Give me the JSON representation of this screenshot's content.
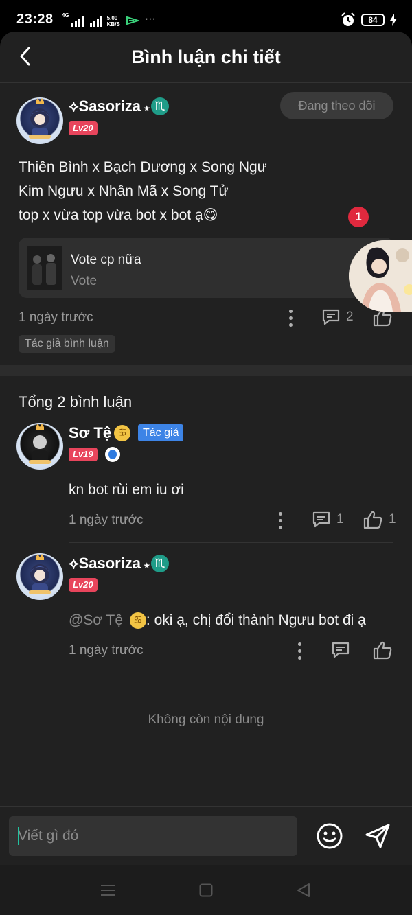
{
  "status_bar": {
    "time": "23:28",
    "network": "4G",
    "speed_value": "5.00",
    "speed_unit": "KB/S",
    "more": "···",
    "battery": "84"
  },
  "header": {
    "title": "Bình luận chi tiết"
  },
  "post": {
    "username": "Sasoriza",
    "zodiac_glyph": "♏",
    "level": "Lv20",
    "follow_label": "Đang theo dõi",
    "lines": [
      "Thiên Bình x Bạch Dương x Song Ngư",
      "Kim Ngưu x Nhân Mã x Song Tử",
      "top x vừa top vừa bot x bot ạ😋"
    ],
    "vote": {
      "title": "Vote cp nữa",
      "subtitle": "Vote"
    },
    "time": "1 ngày trước",
    "reply_count": "2",
    "author_tag": "Tác giả bình luận"
  },
  "floating": {
    "badge": "1"
  },
  "comments_section": {
    "total": "Tổng 2 bình luận",
    "comments": [
      {
        "username": "Sơ Tệ",
        "zodiac_glyph": "♋",
        "author_pill": "Tác giả",
        "level": "Lv19",
        "text": "kn bot rùi em iu ơi",
        "time": "1 ngày trước",
        "reply_count": "1",
        "like_count": "1"
      },
      {
        "username": "Sasoriza",
        "zodiac_glyph": "♏",
        "level": "Lv20",
        "mention": "@Sơ Tệ",
        "mention_glyph": "♋",
        "text": ": oki ạ, chị đổi thành Ngưu bot đi ạ",
        "time": "1 ngày trước"
      }
    ],
    "no_more": "Không còn nội dung"
  },
  "input": {
    "placeholder": "Viết gì đó"
  },
  "colors": {
    "background": "#212121",
    "level_badge": "#e8455c",
    "author_pill": "#3d84e6",
    "scorpio_badge": "#1f9c88",
    "cancer_badge": "#f2c444",
    "notification": "#e0293e",
    "caret": "#21c3a0"
  },
  "icons": [
    "back-arrow-icon",
    "comment-icon",
    "like-icon",
    "more-dots-icon",
    "emoji-icon",
    "send-icon",
    "menu-icon",
    "home-icon",
    "back-triangle-icon"
  ]
}
